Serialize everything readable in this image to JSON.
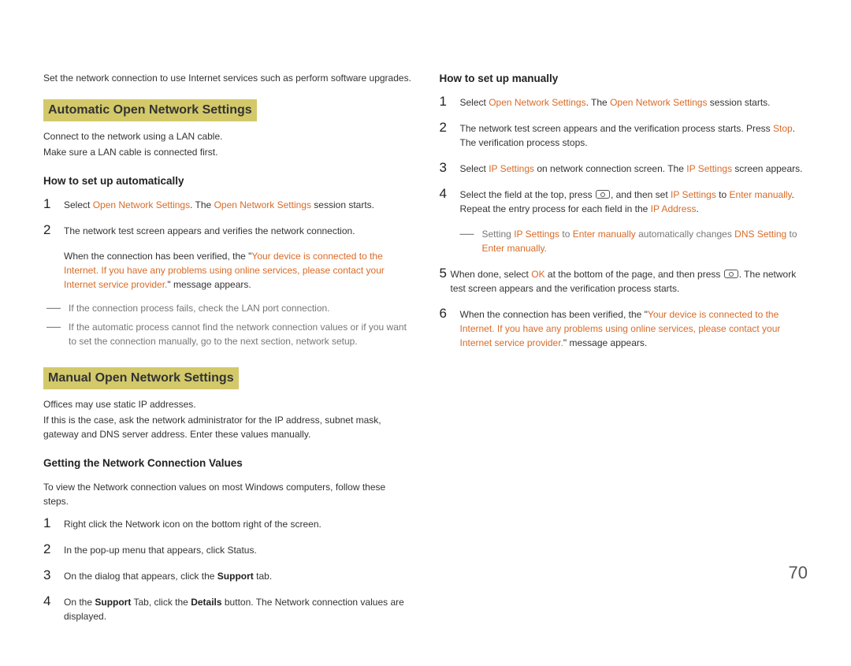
{
  "pageNumber": "70",
  "left": {
    "intro": "Set the network connection to use Internet services such as perform software upgrades.",
    "heading1": "Automatic Open Network Settings",
    "h1_line1": "Connect to the network using a LAN cable.",
    "h1_line2": "Make sure a LAN cable is connected first.",
    "sub1": "How to set up automatically",
    "s1_n1": "1",
    "s1_t1_a": "Select ",
    "s1_t1_b": "Open Network Settings",
    "s1_t1_c": ". The ",
    "s1_t1_d": "Open Network Settings",
    "s1_t1_e": " session starts.",
    "s1_n2": "2",
    "s1_t2": "The network test screen appears and verifies the network connection.",
    "s1_conn_a": "When the connection has been verified, the \"",
    "s1_conn_b": "Your device is connected to the Internet. If you have any problems using online services, please contact your Internet service provider.",
    "s1_conn_c": "\" message appears.",
    "s1_d1": "If the connection process fails, check the LAN port connection.",
    "s1_d2": "If the automatic process cannot find the network connection values or if you want to set the connection manually, go to the next section, network setup.",
    "heading2": "Manual Open Network Settings",
    "h2_line1": "Offices may use static IP addresses.",
    "h2_line2": "If this is the case, ask the network administrator for the IP address, subnet mask, gateway and DNS server address. Enter these values manually.",
    "sub2": "Getting the Network Connection Values",
    "s2_intro": "To view the Network connection values on most Windows computers, follow these steps.",
    "s2_n1": "1",
    "s2_t1": "Right click the Network icon on the bottom right of the screen.",
    "s2_n2": "2",
    "s2_t2": "In the pop-up menu that appears, click Status.",
    "s2_n3": "3",
    "s2_t3_a": "On the dialog that appears, click the ",
    "s2_t3_b": "Support",
    "s2_t3_c": " tab.",
    "s2_n4": "4",
    "s2_t4_a": "On the ",
    "s2_t4_b": "Support",
    "s2_t4_c": " Tab, click the ",
    "s2_t4_d": "Details",
    "s2_t4_e": " button. The Network connection values are displayed."
  },
  "right": {
    "sub1": "How to set up manually",
    "r_n1": "1",
    "r_t1_a": "Select ",
    "r_t1_b": "Open Network Settings",
    "r_t1_c": ". The ",
    "r_t1_d": "Open Network Settings",
    "r_t1_e": " session starts.",
    "r_n2": "2",
    "r_t2_a": "The network test screen appears and the verification process starts. Press ",
    "r_t2_b": "Stop",
    "r_t2_c": ". The verification process stops.",
    "r_n3": "3",
    "r_t3_a": "Select ",
    "r_t3_b": "IP Settings",
    "r_t3_c": " on network connection screen. The ",
    "r_t3_d": "IP Settings",
    "r_t3_e": " screen appears.",
    "r_n4": "4",
    "r_t4_a": "Select the field at the top, press ",
    "r_t4_b": ", and then set ",
    "r_t4_c": "IP Settings",
    "r_t4_d": " to ",
    "r_t4_e": "Enter manually",
    "r_t4_f": ". Repeat the entry process for each field in the ",
    "r_t4_g": "IP Address",
    "r_t4_h": ".",
    "r_d_a": "Setting ",
    "r_d_b": "IP Settings",
    "r_d_c": " to ",
    "r_d_d": "Enter manually",
    "r_d_e": " automatically changes ",
    "r_d_f": "DNS Setting",
    "r_d_g": " to ",
    "r_d_h": "Enter manually",
    "r_d_i": ".",
    "r_n5": "5",
    "r_t5_a": "When done, select ",
    "r_t5_b": "OK",
    "r_t5_c": " at the bottom of the page, and then press ",
    "r_t5_d": ". The network test screen appears and the verification process starts.",
    "r_n6": "6",
    "r_t6_a": "When the connection has been verified, the \"",
    "r_t6_b": "Your device is connected to the Internet. If you have any problems using online services, please contact your Internet service provider.",
    "r_t6_c": "\" message appears."
  }
}
